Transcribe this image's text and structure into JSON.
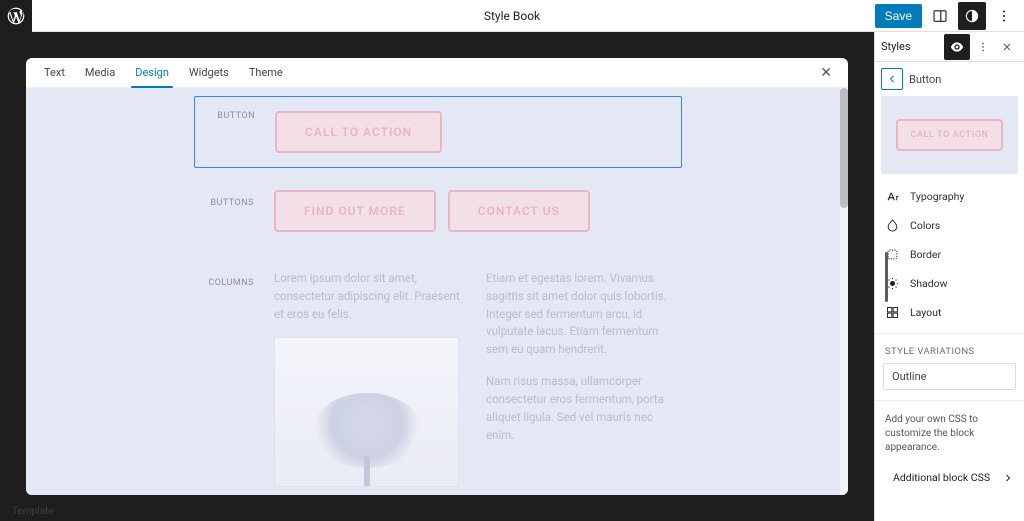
{
  "topbar": {
    "title": "Style Book",
    "save_label": "Save"
  },
  "tabs": {
    "text": "Text",
    "media": "Media",
    "design": "Design",
    "widgets": "Widgets",
    "theme": "Theme"
  },
  "stylebook": {
    "button_label": "BUTTON",
    "buttons_label": "BUTTONS",
    "columns_label": "COLUMNS",
    "cta": "CALL TO ACTION",
    "find_out": "FIND OUT MORE",
    "contact": "CONTACT US",
    "col1_p1": "Lorem ipsum dolor sit amet, consectetur adipiscing elit. Praesent et eros eu felis.",
    "col2_p1": "Etiam et egestas lorem. Vivamus sagittis sit amet dolor quis lobortis. Integer sed fermentum arcu, id vulputate lacus. Etiam fermentum sem eu quam hendrerit.",
    "col2_p2": "Nam risus massa, ullamcorper consectetur eros fermentum, porta aliquet ligula. Sed vel mauris nec enim."
  },
  "sidebar": {
    "styles_title": "Styles",
    "back_label": "Button",
    "preview_cta": "CALL TO ACTION",
    "rows": {
      "typography": "Typography",
      "colors": "Colors",
      "border": "Border",
      "shadow": "Shadow",
      "layout": "Layout"
    },
    "variations_label": "STYLE VARIATIONS",
    "outline": "Outline",
    "css_note": "Add your own CSS to customize the block appearance.",
    "additional_css": "Additional block CSS"
  },
  "footer": {
    "template": "Template"
  }
}
